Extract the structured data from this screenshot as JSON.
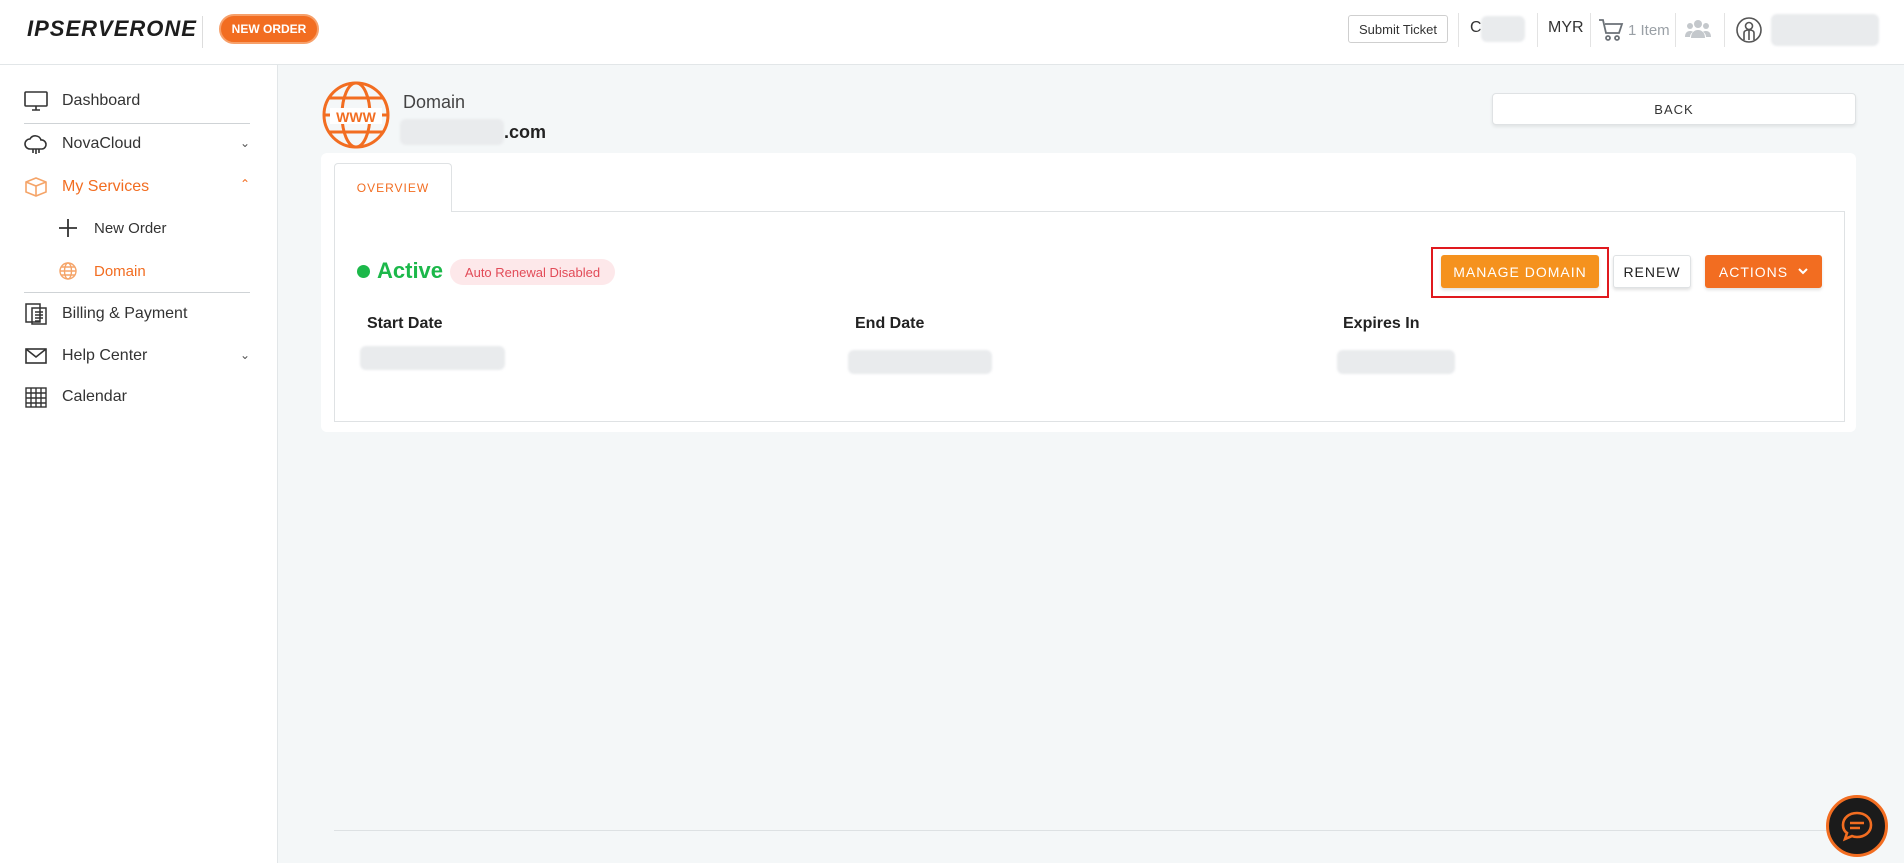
{
  "header": {
    "logo": "IPSERVERONE",
    "new_order": "NEW ORDER",
    "submit_ticket": "Submit Ticket",
    "credit_prefix": "C",
    "currency": "MYR",
    "cart": "1 Item"
  },
  "sidebar": {
    "items": [
      {
        "label": "Dashboard",
        "icon": "monitor-icon"
      },
      {
        "label": "NovaCloud",
        "icon": "cloud-icon"
      },
      {
        "label": "My Services",
        "icon": "box-icon"
      },
      {
        "label": "Billing & Payment",
        "icon": "invoice-icon"
      },
      {
        "label": "Help Center",
        "icon": "mail-icon"
      },
      {
        "label": "Calendar",
        "icon": "calendar-icon"
      }
    ],
    "subitems": [
      {
        "label": "New Order",
        "icon": "plus-icon"
      },
      {
        "label": "Domain",
        "icon": "globe-icon"
      }
    ]
  },
  "page": {
    "type_label": "Domain",
    "domain_suffix": ".com",
    "back": "BACK",
    "tab_overview": "OVERVIEW",
    "www": "WWW"
  },
  "status": {
    "state": "Active",
    "renewal": "Auto Renewal Disabled"
  },
  "actions": {
    "manage_domain": "MANAGE DOMAIN",
    "renew": "RENEW",
    "actions": "ACTIONS"
  },
  "details": {
    "start_date_label": "Start Date",
    "end_date_label": "End Date",
    "expires_in_label": "Expires In"
  },
  "colors": {
    "brand_orange": "#f26d21",
    "manage_orange": "#f5921e",
    "active_green": "#1cb84a",
    "badge_red": "#e24b58"
  }
}
